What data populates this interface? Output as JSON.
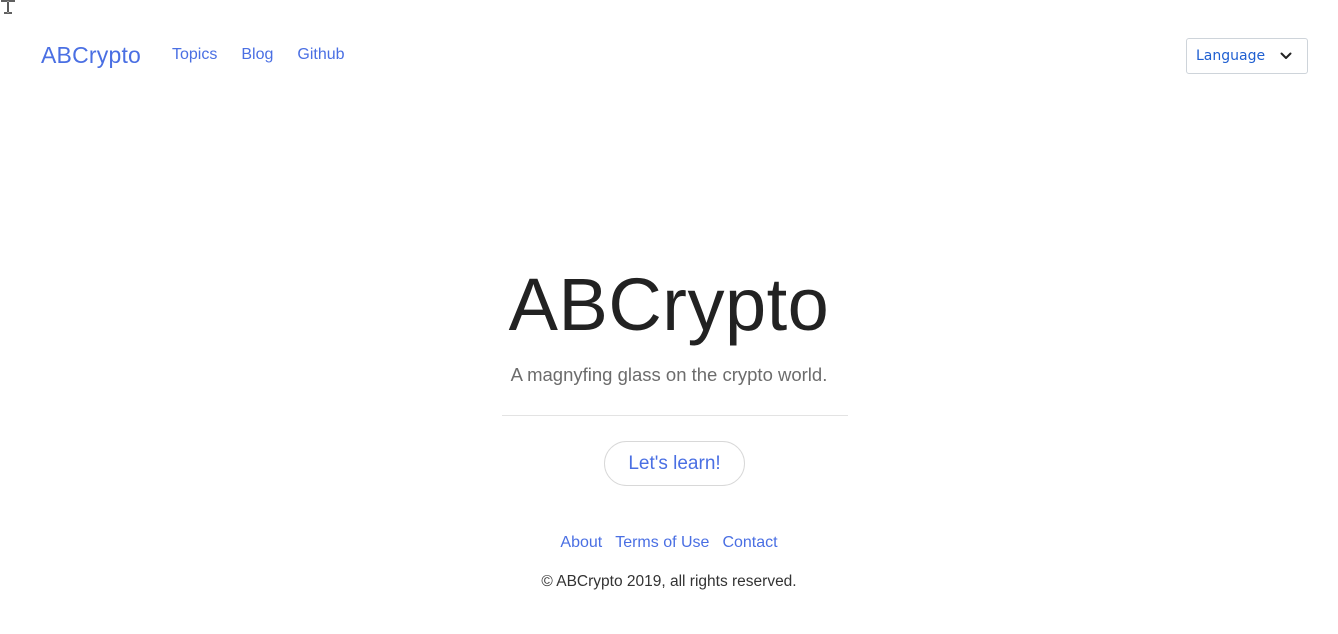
{
  "navbar": {
    "brand": "ABCrypto",
    "links": [
      {
        "label": "Topics"
      },
      {
        "label": "Blog"
      },
      {
        "label": "Github"
      }
    ],
    "language_select": {
      "selected": "Language",
      "icon": "chevron-down-icon"
    }
  },
  "hero": {
    "title": "ABCrypto",
    "subtitle": "A magnyfing glass on the crypto world.",
    "cta_label": "Let's learn!"
  },
  "footer": {
    "links": [
      {
        "label": "About"
      },
      {
        "label": "Terms of Use"
      },
      {
        "label": "Contact"
      }
    ],
    "copyright": "© ABCrypto 2019, all rights reserved."
  },
  "colors": {
    "accent": "#4a6fe3",
    "text": "#222222",
    "muted": "#6c6c6c",
    "border": "#ced4da"
  }
}
